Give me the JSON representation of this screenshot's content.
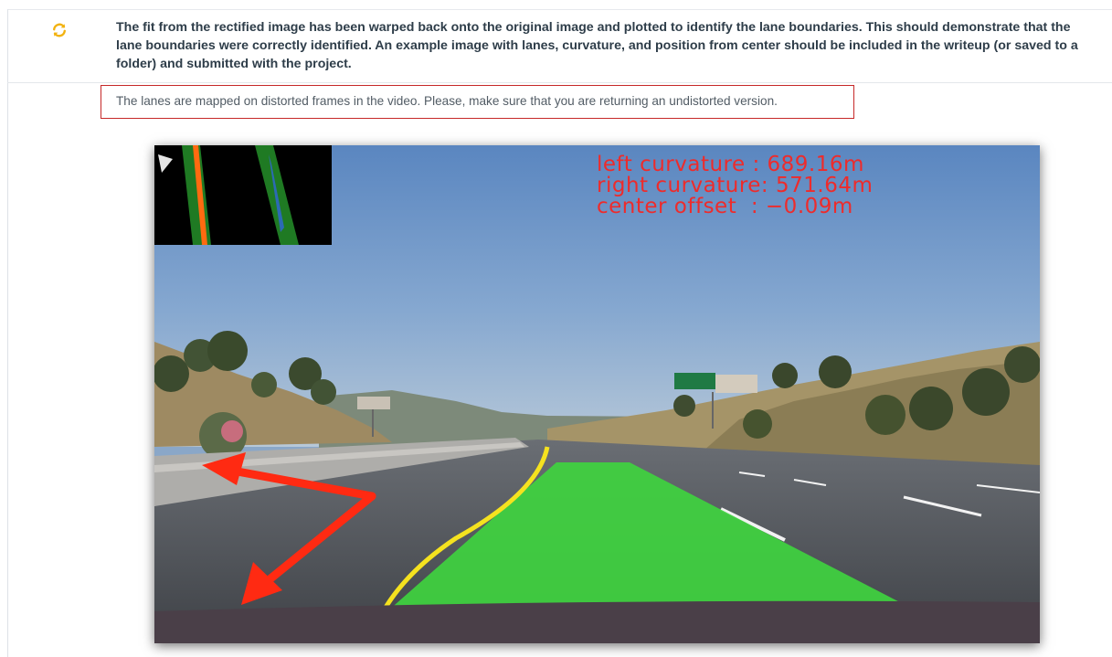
{
  "review": {
    "status_icon": "refresh-icon",
    "criteria_text": "The fit from the rectified image has been warped back onto the original image and plotted to identify the lane boundaries. This should demonstrate that the lane boundaries were correctly identified. An example image with lanes, curvature, and position from center should be included in the writeup (or saved to a folder) and submitted with the project.",
    "reviewer_note": "The lanes are mapped on distorted frames in the video. Please, make sure that you are returning an undistorted version."
  },
  "frame_overlay": {
    "left_curvature": "left curvature : 689.16m",
    "right_curvature": "right curvature: 571.64m",
    "center_offset": "center offset  : −0.09m"
  },
  "colors": {
    "status_icon": "#f2b20f",
    "note_border": "#c62828",
    "overlay_text": "#ee2b2b",
    "lane_fill": "#3fd33f",
    "arrow": "#ff2a12"
  }
}
